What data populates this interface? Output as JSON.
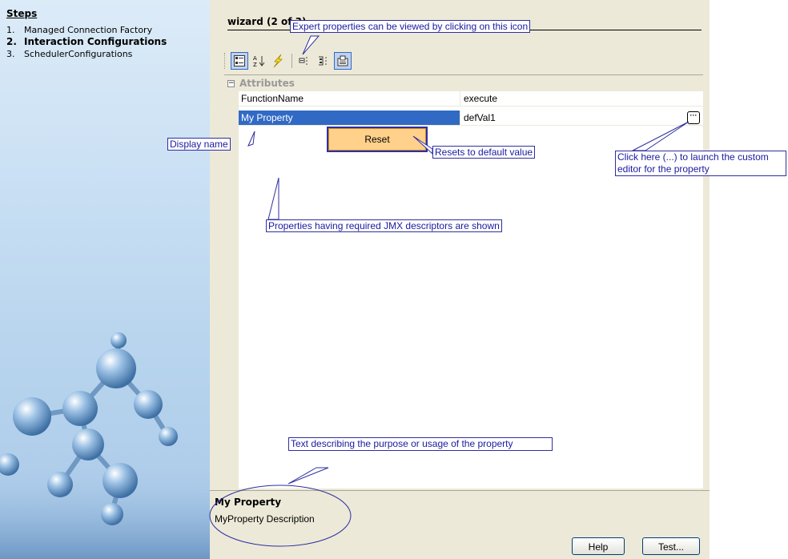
{
  "steps": {
    "title": "Steps",
    "items": [
      {
        "num": "1.",
        "label": "Managed Connection Factory"
      },
      {
        "num": "2.",
        "label": "Interaction Configurations"
      },
      {
        "num": "3.",
        "label": "SchedulerConfigurations"
      }
    ],
    "active_index": 1
  },
  "wizard": {
    "title": "wizard (2 of 3)"
  },
  "toolbar": {
    "icons": [
      "categorized-icon",
      "alphabetical-sort-icon",
      "expert-properties-icon",
      "event-icon",
      "method-icon",
      "properties-icon"
    ]
  },
  "properties": {
    "group_label": "Attributes",
    "collapse_glyph": "⊟",
    "rows": [
      {
        "name": "FunctionName",
        "value": "execute"
      },
      {
        "name": "My Property",
        "value": "defVal1"
      }
    ],
    "ellipsis_label": "···"
  },
  "reset_label": "Reset",
  "description": {
    "title": "My Property",
    "text": "MyProperty Description"
  },
  "buttons": {
    "help": "Help",
    "test": "Test..."
  },
  "callouts": {
    "expert": "Expert properties can be viewed by clicking on this icon",
    "display_name": "Display name",
    "resets": "Resets to default value",
    "custom_editor": "Click here (...) to launch the custom editor for the property",
    "jmx": "Properties having required JMX descriptors are shown",
    "desc_purpose": "Text describing the purpose or usage of the property"
  },
  "colors": {
    "selection": "#316ac5",
    "callout": "#2f2fa0",
    "panel": "#ece9d8"
  }
}
